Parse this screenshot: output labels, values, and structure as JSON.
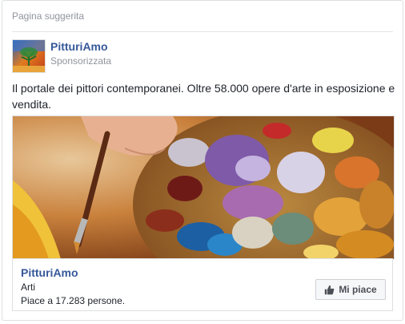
{
  "header": {
    "title": "Pagina suggerita"
  },
  "page": {
    "name": "PitturiAmo",
    "sponsored": "Sponsorizzata"
  },
  "post": {
    "text": "Il portale dei pittori contemporanei. Oltre 58.000 opere d'arte in esposizione e vendita."
  },
  "footer": {
    "name": "PitturiAmo",
    "category": "Arti",
    "likes": "Piace a 17.283 persone.",
    "like_button": "Mi piace"
  },
  "icons": {
    "thumbs_up": "thumbs-up-icon"
  },
  "colors": {
    "link": "#365899",
    "muted": "#90949c",
    "border": "#dddfe2"
  }
}
